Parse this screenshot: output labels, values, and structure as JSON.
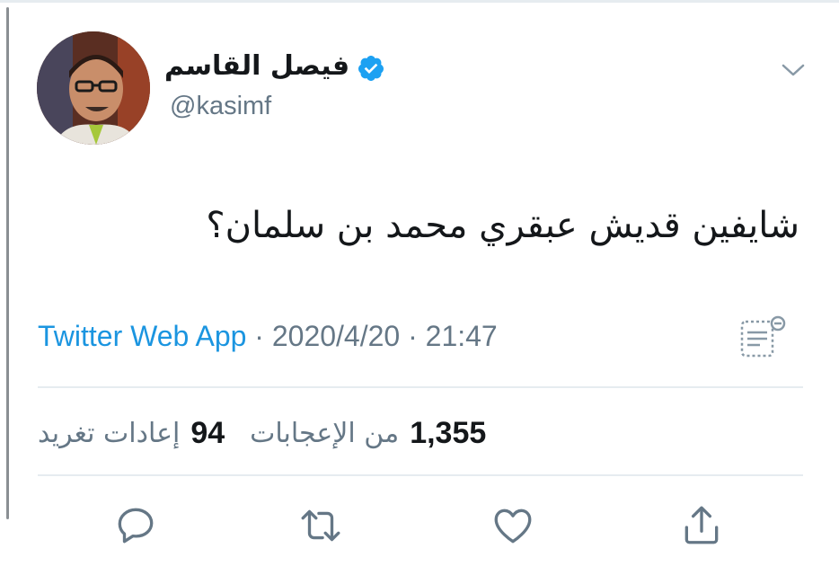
{
  "author": {
    "display_name": "فيصل القاسم",
    "handle": "@kasimf",
    "verified": true
  },
  "tweet": {
    "text": "شايفين قديش عبقري محمد بن سلمان؟",
    "source": "Twitter Web App",
    "separator": " · ",
    "date": "2020/4/20",
    "time": "21:47"
  },
  "stats": {
    "likes_count": "1,355",
    "likes_label": "من الإعجابات",
    "retweets_count": "94",
    "retweets_label": "إعادات تغريد"
  },
  "icons": {
    "verified": "verified-badge-icon",
    "chevron": "chevron-down-icon",
    "analytics": "analytics-icon",
    "reply": "reply-icon",
    "retweet": "retweet-icon",
    "like": "heart-icon",
    "share": "share-icon"
  },
  "colors": {
    "link": "#1b95e0",
    "muted": "#657786",
    "text": "#14171a",
    "divider": "#e6ecf0"
  }
}
